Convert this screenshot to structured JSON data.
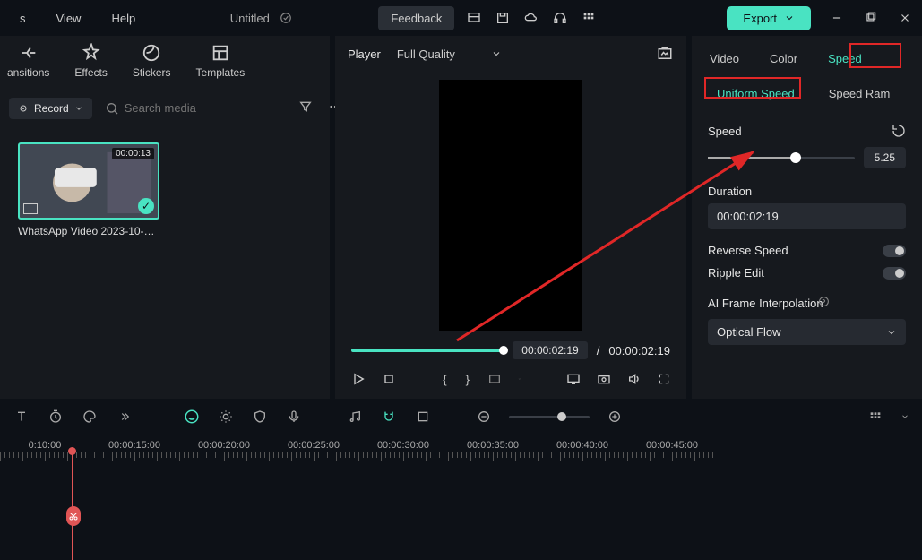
{
  "menu": {
    "view": "View",
    "help": "Help"
  },
  "title": "Untitled",
  "feedback": "Feedback",
  "export": "Export",
  "media": {
    "tabs": {
      "transitions": "ansitions",
      "effects": "Effects",
      "stickers": "Stickers",
      "templates": "Templates"
    },
    "record": "Record",
    "search_ph": "Search media",
    "clip": {
      "duration": "00:00:13",
      "name": "WhatsApp Video 2023-10-05..."
    }
  },
  "player": {
    "label": "Player",
    "quality": "Full Quality",
    "cur": "00:00:02:19",
    "sep": "/",
    "dur": "00:00:02:19"
  },
  "rp": {
    "tabs": {
      "video": "Video",
      "color": "Color",
      "speed": "Speed"
    },
    "subtabs": {
      "uniform": "Uniform Speed",
      "ramp": "Speed Ram"
    },
    "speed_label": "Speed",
    "speed_val": "5.25",
    "duration_label": "Duration",
    "duration_val": "00:00:02:19",
    "reverse": "Reverse Speed",
    "ripple": "Ripple Edit",
    "ai_label": "AI Frame Interpolation",
    "ai_val": "Optical Flow"
  },
  "timeline": {
    "marks": [
      "0:10:00",
      "00:00:15:00",
      "00:00:20:00",
      "00:00:25:00",
      "00:00:30:00",
      "00:00:35:00",
      "00:00:40:00",
      "00:00:45:00"
    ]
  }
}
